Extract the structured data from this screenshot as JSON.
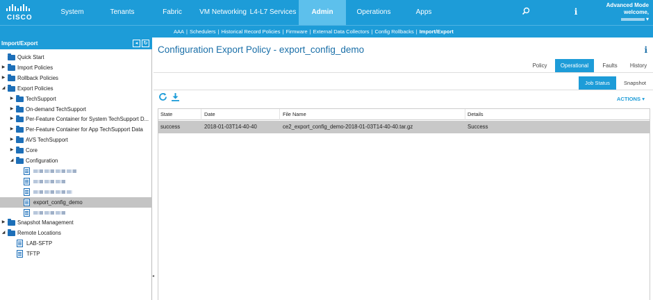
{
  "brand": {
    "wordmark": "CISCO"
  },
  "topnav": {
    "tabs": [
      "System",
      "Tenants",
      "Fabric",
      "VM Networking",
      "L4-L7 Services",
      "Admin",
      "Operations",
      "Apps"
    ],
    "active": "Admin",
    "user": {
      "mode": "Advanced Mode",
      "welcome": "welcome,"
    }
  },
  "subnav": {
    "items": [
      "AAA",
      "Schedulers",
      "Historical Record Policies",
      "Firmware",
      "External Data Collectors",
      "Config Rollbacks",
      "Import/Export"
    ],
    "active": "Import/Export",
    "separator": "|"
  },
  "sidebar": {
    "title": "Import/Export",
    "tree": [
      {
        "label": "Quick Start",
        "type": "folder",
        "depth": 0,
        "caret": ""
      },
      {
        "label": "Import Policies",
        "type": "folder",
        "depth": 0,
        "caret": "▶"
      },
      {
        "label": "Rollback Policies",
        "type": "folder",
        "depth": 0,
        "caret": "▶"
      },
      {
        "label": "Export Policies",
        "type": "folder",
        "depth": 0,
        "caret": "◢"
      },
      {
        "label": "TechSupport",
        "type": "folder",
        "depth": 1,
        "caret": "▶"
      },
      {
        "label": "On-demand TechSupport",
        "type": "folder",
        "depth": 1,
        "caret": "▶"
      },
      {
        "label": "Per-Feature Container for System TechSupport D...",
        "type": "folder",
        "depth": 1,
        "caret": "▶"
      },
      {
        "label": "Per-Feature Container for App TechSupport Data",
        "type": "folder",
        "depth": 1,
        "caret": "▶"
      },
      {
        "label": "AVS TechSupport",
        "type": "folder",
        "depth": 1,
        "caret": "▶"
      },
      {
        "label": "Core",
        "type": "folder",
        "depth": 1,
        "caret": "▶"
      },
      {
        "label": "Configuration",
        "type": "folder",
        "depth": 1,
        "caret": "◢"
      },
      {
        "label": "",
        "type": "doc-blurred",
        "depth": 2,
        "caret": ""
      },
      {
        "label": "",
        "type": "doc-blurred",
        "depth": 2,
        "caret": ""
      },
      {
        "label": "",
        "type": "doc-blurred",
        "depth": 2,
        "caret": ""
      },
      {
        "label": "export_config_demo",
        "type": "doc",
        "depth": 2,
        "caret": "",
        "selected": true
      },
      {
        "label": "",
        "type": "doc-blurred",
        "depth": 2,
        "caret": ""
      },
      {
        "label": "Snapshot Management",
        "type": "folder",
        "depth": 0,
        "caret": "▶"
      },
      {
        "label": "Remote Locations",
        "type": "folder",
        "depth": 0,
        "caret": "◢"
      },
      {
        "label": "LAB-SFTP",
        "type": "doc",
        "depth": 1,
        "caret": ""
      },
      {
        "label": "TFTP",
        "type": "doc",
        "depth": 1,
        "caret": ""
      }
    ]
  },
  "main": {
    "title": "Configuration Export Policy - export_config_demo",
    "tabs": [
      "Policy",
      "Operational",
      "Faults",
      "History"
    ],
    "active_tab": "Operational",
    "subtabs": [
      "Job Status",
      "Snapshot"
    ],
    "active_subtab": "Job Status",
    "actions_label": "ACTIONS ▾",
    "table": {
      "columns": [
        "State",
        "Date",
        "File Name",
        "Details"
      ],
      "rows": [
        [
          "success",
          "2018-01-03T14-40-40",
          "ce2_export_config_demo-2018-01-03T14-40-40.tar.gz",
          "Success"
        ]
      ]
    }
  },
  "colors": {
    "brand_blue": "#1d9cd8",
    "active_tab": "#5dc0ec",
    "title_blue": "#1a6fa8",
    "folder_blue": "#1d6fb8"
  }
}
